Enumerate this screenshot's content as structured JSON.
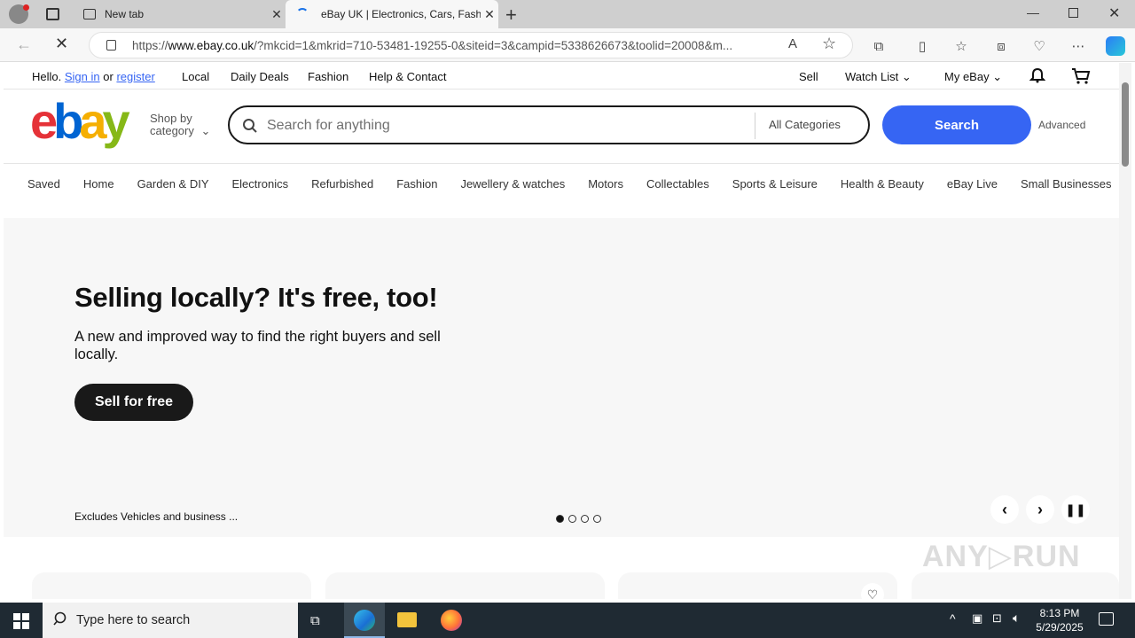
{
  "browser": {
    "tabs": [
      {
        "label": "New tab",
        "icon": "newtab-icon"
      },
      {
        "label": "eBay UK | Electronics, Cars, Fashi",
        "icon": "loading-icon"
      }
    ],
    "url_prefix": "https://",
    "url_domain": "www.ebay.co.uk",
    "url_rest": "/?mkcid=1&mkrid=710-53481-19255-0&siteid=3&campid=5338626673&toolid=20008&m..."
  },
  "header": {
    "hello": "Hello.",
    "sign_in": "Sign in",
    "or": "or",
    "register": "register",
    "links": [
      "Local",
      "Daily Deals",
      "Fashion",
      "Help & Contact"
    ],
    "sell": "Sell",
    "watch_list": "Watch List",
    "my_ebay": "My eBay"
  },
  "search": {
    "shop_by": "Shop by",
    "category": "category",
    "placeholder": "Search for anything",
    "all_categories": "All Categories",
    "button": "Search",
    "advanced": "Advanced"
  },
  "categories": [
    "Saved",
    "Home",
    "Garden & DIY",
    "Electronics",
    "Refurbished",
    "Fashion",
    "Jewellery & watches",
    "Motors",
    "Collectables",
    "Sports & Leisure",
    "Health & Beauty",
    "eBay Live",
    "Small Businesses"
  ],
  "hero": {
    "title": "Selling locally? It's free, too!",
    "subtitle": "A new and improved way to find the right buyers and sell locally.",
    "cta": "Sell for free",
    "footnote": "Excludes Vehicles and business ..."
  },
  "taskbar": {
    "search_placeholder": "Type here to search",
    "time": "8:13 PM",
    "date": "5/29/2025"
  },
  "colors": {
    "ebay_red": "#e53238",
    "ebay_blue": "#0064d2",
    "ebay_yellow": "#f5af02",
    "ebay_green": "#86b817",
    "accent": "#3665f3"
  }
}
